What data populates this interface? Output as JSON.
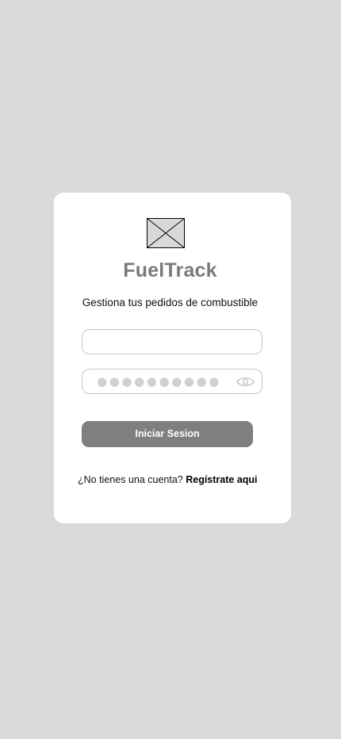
{
  "app": {
    "title": "FuelTrack",
    "tagline": "Gestiona tus pedidos de combustible"
  },
  "login": {
    "username_value": "",
    "password_mask": "●●●●●●●●●●",
    "submit_label": "Iniciar Sesion",
    "signup_prompt": "¿No tienes una cuenta?",
    "signup_link": "Regístrate aqui"
  },
  "icons": {
    "logo": "image-placeholder-icon",
    "password_toggle": "eye-icon"
  },
  "colors": {
    "background": "#d9d9d9",
    "card": "#ffffff",
    "title": "#7a7a7a",
    "button": "#7f7f7f",
    "button_text": "#ffffff",
    "field_border": "#c6c6c6"
  }
}
